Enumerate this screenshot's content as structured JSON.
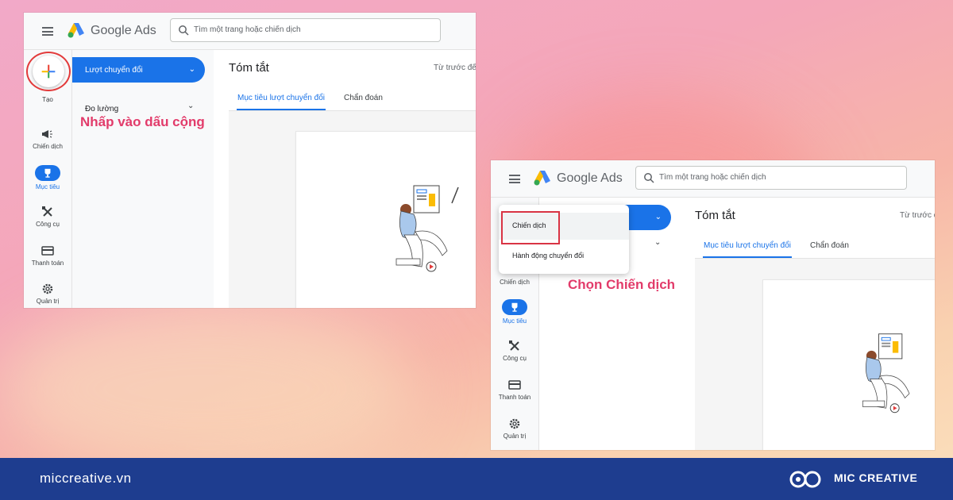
{
  "screenshot1": {
    "app_name": "Google Ads",
    "search_placeholder": "Tìm một trang hoặc chiến dịch",
    "nav": {
      "create_label": "Tạo",
      "campaigns_label": "Chiến dịch",
      "goals_label": "Mục tiêu",
      "tools_label": "Công cụ",
      "billing_label": "Thanh toán",
      "admin_label": "Quản trị"
    },
    "subnav": {
      "active_label": "Lượt chuyển đổi",
      "measurement_label": "Đo lường"
    },
    "content": {
      "title": "Tóm tắt",
      "date_range": "Từ trước đế",
      "tab_conversion_goals": "Mục tiêu lượt chuyển đổi",
      "tab_diagnostics": "Chẩn đoán"
    },
    "annotation": "Nhấp vào dấu cộng"
  },
  "screenshot2": {
    "app_name": "Google Ads",
    "search_placeholder": "Tìm một trang hoặc chiến dịch",
    "dropdown": {
      "item_campaign": "Chiến dịch",
      "item_conversion_action": "Hành động chuyển đổi"
    },
    "nav": {
      "campaigns_label": "Chiến dịch",
      "goals_label": "Mục tiêu",
      "tools_label": "Công cụ",
      "billing_label": "Thanh toán",
      "admin_label": "Quản trị"
    },
    "content": {
      "title": "Tóm tắt",
      "date_range": "Từ trước đế",
      "tab_conversion_goals": "Mục tiêu lượt chuyển đổi",
      "tab_diagnostics": "Chẩn đoán"
    },
    "annotation": "Chọn Chiến dịch"
  },
  "footer": {
    "website": "miccreative.vn",
    "brand": "MIC CREATIVE"
  },
  "colors": {
    "primary_blue": "#1a73e8",
    "annotation_pink": "#e23b6a",
    "highlight_red": "#d93444",
    "footer_navy": "#1e3d8f"
  }
}
